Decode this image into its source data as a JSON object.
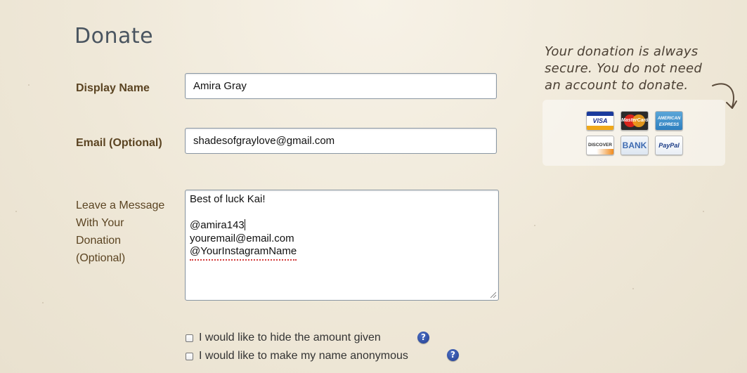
{
  "page": {
    "title": "Donate"
  },
  "form": {
    "display_name": {
      "label": "Display Name",
      "value": "Amira Gray"
    },
    "email": {
      "label": "Email (Optional)",
      "value": "shadesofgraylove@gmail.com"
    },
    "message": {
      "label_lines": [
        "Leave a Message",
        "With Your",
        "Donation",
        "(Optional)"
      ],
      "lines": [
        "Best of luck Kai!",
        "",
        "@amira143",
        "youremail@email.com",
        "@YourInstagramName"
      ]
    },
    "options": [
      {
        "label": "I would like to hide the amount given",
        "checked": false,
        "help": "?"
      },
      {
        "label": "I would like to make my name anonymous",
        "checked": false,
        "help": "?"
      }
    ]
  },
  "security": {
    "note_lines": [
      "Your donation is always",
      "secure. You do not need",
      "an account to donate."
    ],
    "payment_methods": [
      {
        "label": "VISA",
        "icon": "visa-card-icon"
      },
      {
        "label": "MasterCard",
        "icon": "mastercard-card-icon"
      },
      {
        "label": "AMERICAN EXPRESS",
        "icon": "amex-card-icon"
      },
      {
        "label": "DISCOVER",
        "icon": "discover-card-icon"
      },
      {
        "label": "BANK",
        "icon": "bank-card-icon"
      },
      {
        "label": "PayPal",
        "icon": "paypal-card-icon"
      }
    ]
  },
  "colors": {
    "label_brown": "#5b4422",
    "title_slate": "#4a5560",
    "help_blue": "#233e8f"
  }
}
